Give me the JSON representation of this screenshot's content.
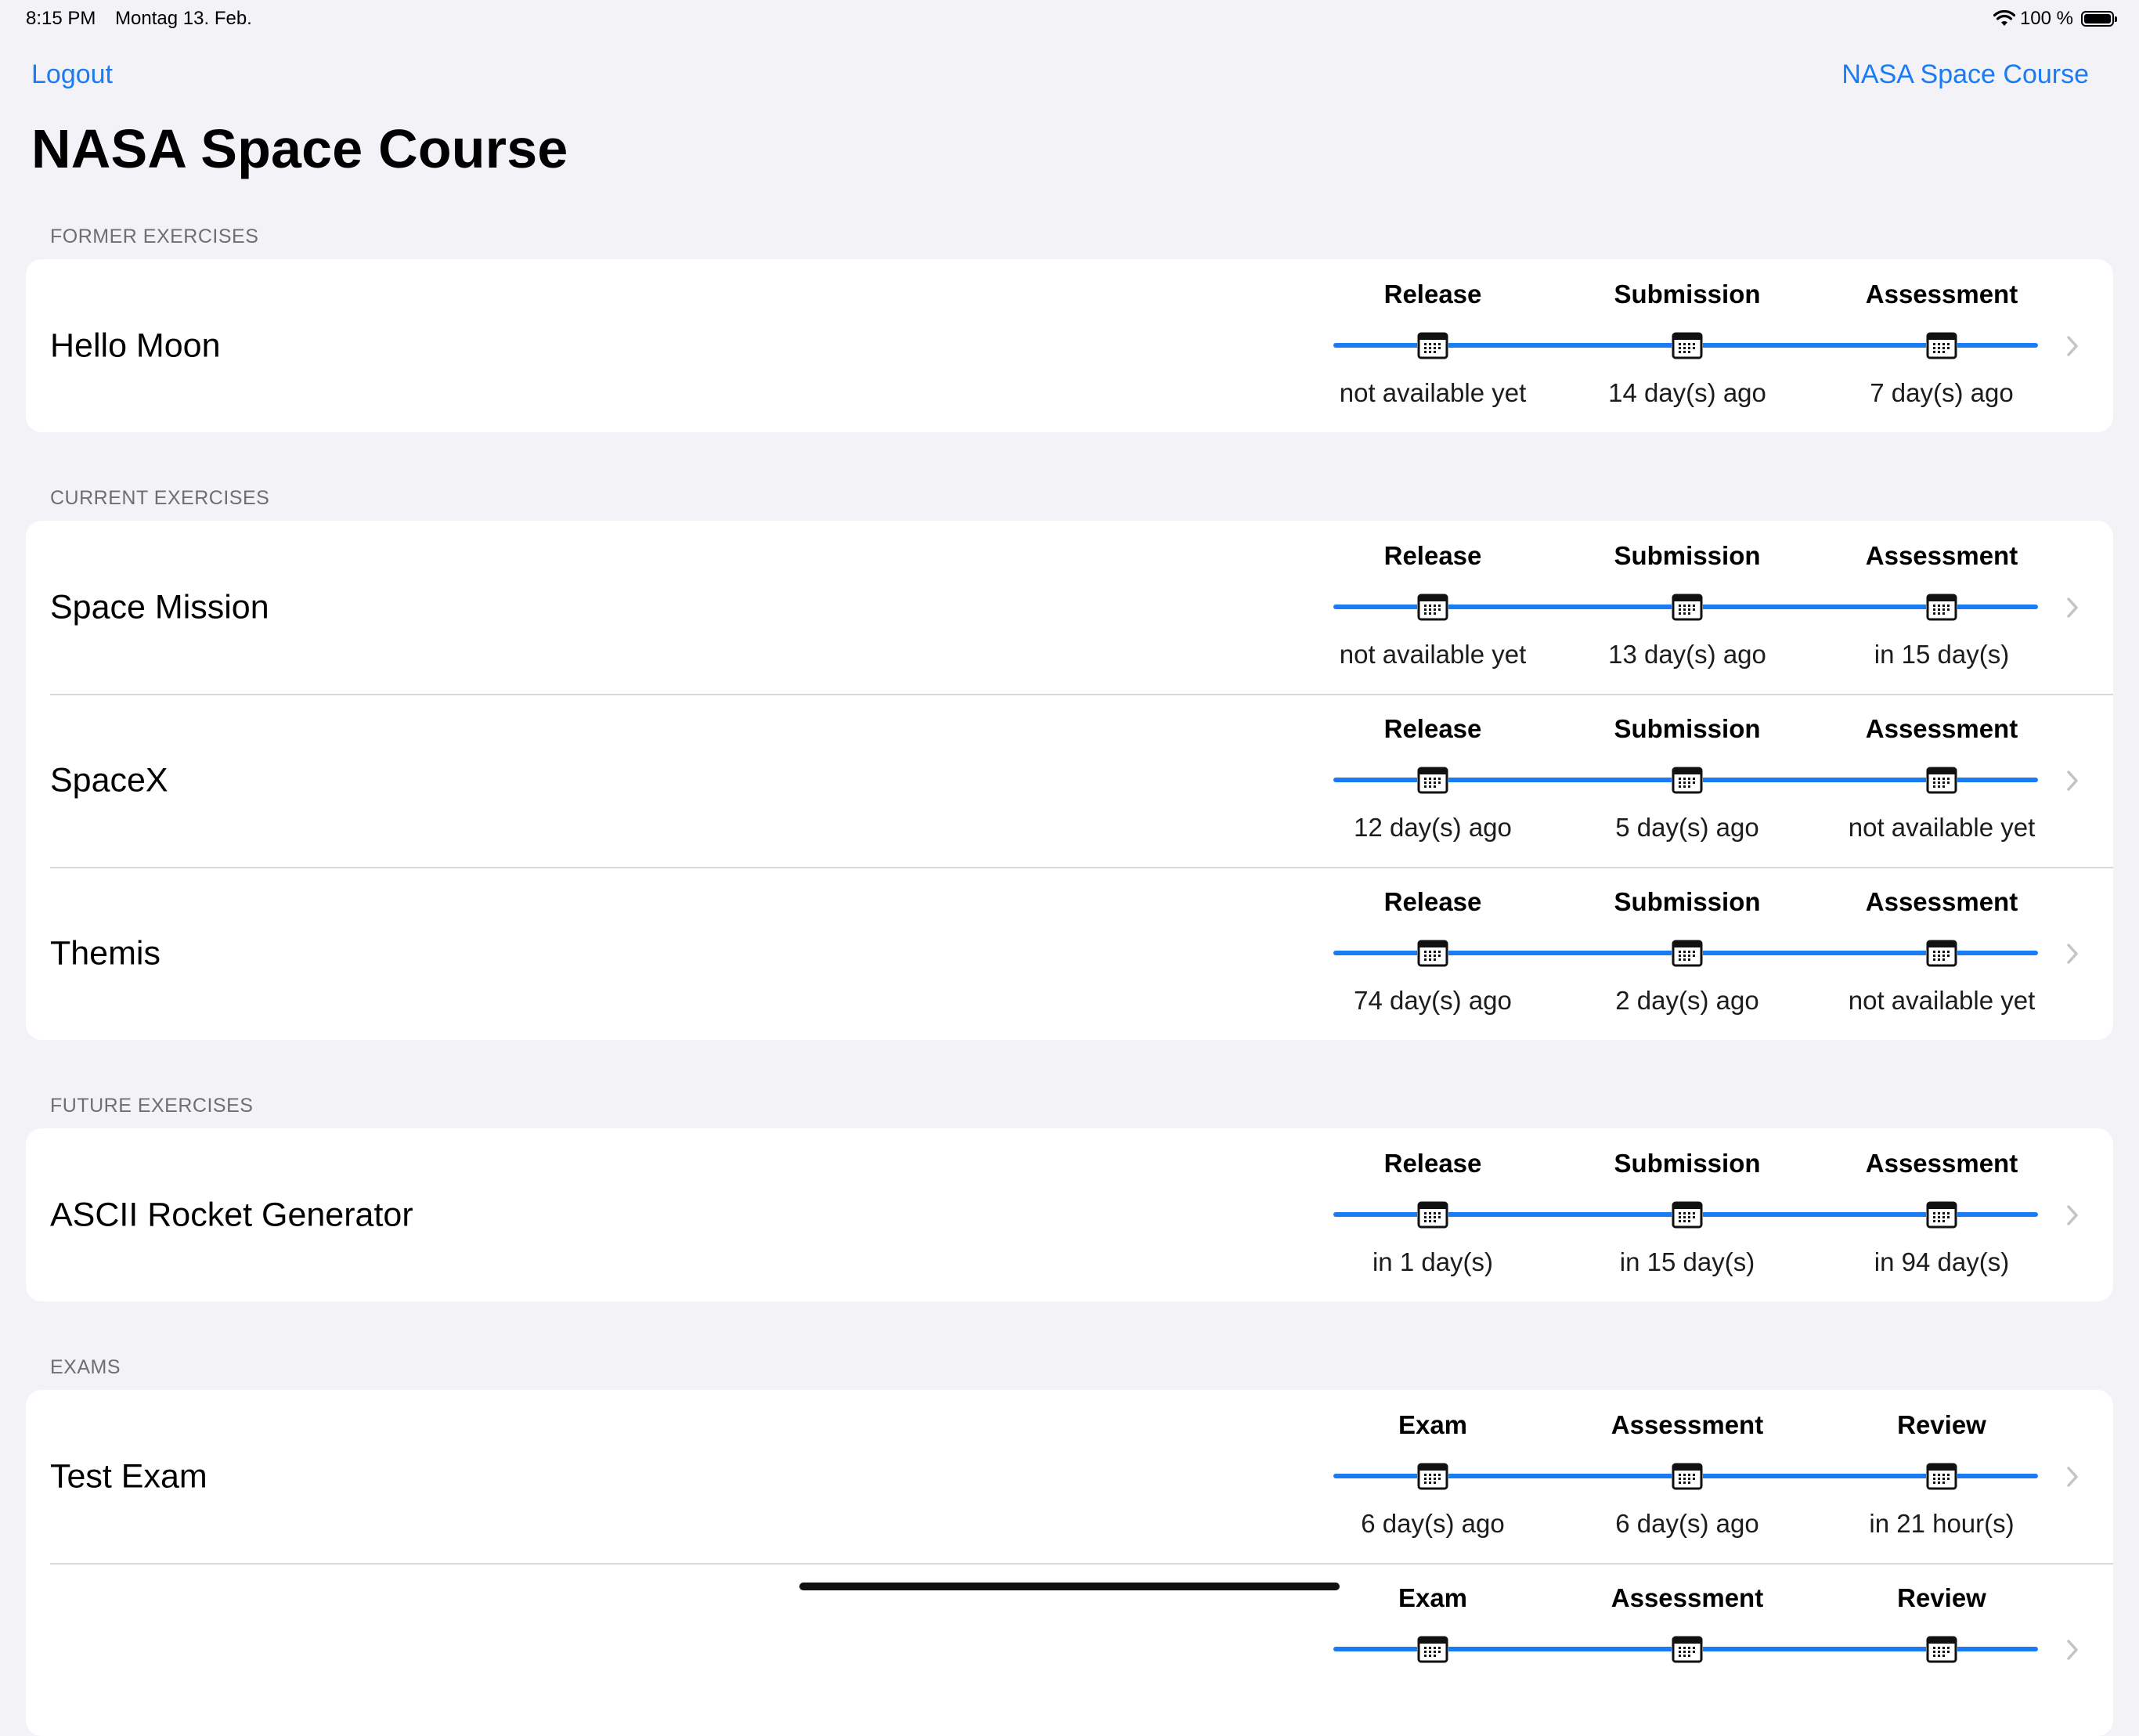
{
  "status_bar": {
    "time": "8:15 PM",
    "date": "Montag 13. Feb.",
    "battery": "100 %",
    "battery_level": 1.0
  },
  "nav": {
    "left_label": "Logout",
    "right_label": "NASA Space Course"
  },
  "title": "NASA Space Course",
  "sections": [
    {
      "header": "FORMER EXERCISES",
      "rows": [
        {
          "name": "Hello Moon",
          "stops": [
            {
              "label": "Release",
              "value": "not available yet"
            },
            {
              "label": "Submission",
              "value": "14 day(s) ago"
            },
            {
              "label": "Assessment",
              "value": "7 day(s) ago"
            }
          ]
        }
      ]
    },
    {
      "header": "CURRENT EXERCISES",
      "rows": [
        {
          "name": "Space Mission",
          "stops": [
            {
              "label": "Release",
              "value": "not available yet"
            },
            {
              "label": "Submission",
              "value": "13 day(s) ago"
            },
            {
              "label": "Assessment",
              "value": "in 15 day(s)"
            }
          ]
        },
        {
          "name": "SpaceX",
          "stops": [
            {
              "label": "Release",
              "value": "12 day(s) ago"
            },
            {
              "label": "Submission",
              "value": "5 day(s) ago"
            },
            {
              "label": "Assessment",
              "value": "not available yet"
            }
          ]
        },
        {
          "name": "Themis",
          "stops": [
            {
              "label": "Release",
              "value": "74 day(s) ago"
            },
            {
              "label": "Submission",
              "value": "2 day(s) ago"
            },
            {
              "label": "Assessment",
              "value": "not available yet"
            }
          ]
        }
      ]
    },
    {
      "header": "FUTURE EXERCISES",
      "rows": [
        {
          "name": "ASCII Rocket Generator",
          "stops": [
            {
              "label": "Release",
              "value": "in 1 day(s)"
            },
            {
              "label": "Submission",
              "value": "in 15 day(s)"
            },
            {
              "label": "Assessment",
              "value": "in 94 day(s)"
            }
          ]
        }
      ]
    },
    {
      "header": "EXAMS",
      "rows": [
        {
          "name": "Test Exam",
          "stops": [
            {
              "label": "Exam",
              "value": "6 day(s) ago"
            },
            {
              "label": "Assessment",
              "value": "6 day(s) ago"
            },
            {
              "label": "Review",
              "value": "in 21 hour(s)"
            }
          ]
        },
        {
          "name": "",
          "stops": [
            {
              "label": "Exam",
              "value": ""
            },
            {
              "label": "Assessment",
              "value": ""
            },
            {
              "label": "Review",
              "value": ""
            }
          ]
        }
      ]
    }
  ],
  "icons": {
    "calendar": "calendar-icon",
    "chevron": "chevron-right-icon",
    "wifi": "wifi-icon",
    "battery": "battery-icon"
  },
  "colors": {
    "accent": "#1a7cf5",
    "background": "#f2f2f7",
    "card": "#ffffff",
    "secondary_text": "#6e6e73"
  }
}
